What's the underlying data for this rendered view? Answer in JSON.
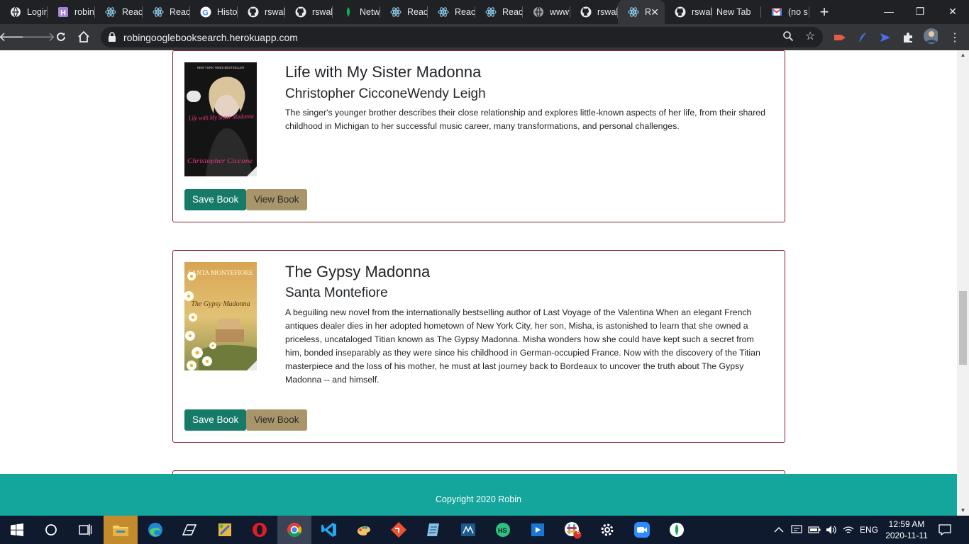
{
  "browser": {
    "tabs": [
      {
        "label": "Login",
        "icon": "globe-icon"
      },
      {
        "label": "robin",
        "icon": "heroku-icon"
      },
      {
        "label": "React",
        "icon": "react-icon"
      },
      {
        "label": "React",
        "icon": "react-icon"
      },
      {
        "label": "Histo",
        "icon": "google-icon"
      },
      {
        "label": "rswal",
        "icon": "github-icon"
      },
      {
        "label": "rswal",
        "icon": "github-icon"
      },
      {
        "label": "Netw",
        "icon": "mongodb-leaf-icon"
      },
      {
        "label": "React",
        "icon": "react-icon"
      },
      {
        "label": "React",
        "icon": "react-icon"
      },
      {
        "label": "React",
        "icon": "react-icon"
      },
      {
        "label": "www",
        "icon": "globe-icon"
      },
      {
        "label": "rswal",
        "icon": "github-icon"
      },
      {
        "label": "R",
        "icon": "react-icon",
        "active": true
      },
      {
        "label": "rswal",
        "icon": "github-icon"
      },
      {
        "label": "New Tab",
        "icon": ""
      },
      {
        "label": "(no s",
        "icon": "gmail-icon"
      }
    ],
    "url": "robingooglebooksearch.herokuapp.com"
  },
  "books": [
    {
      "title": "Life with My Sister Madonna",
      "authors": "Christopher CicconeWendy Leigh",
      "description": "The singer's younger brother describes their close relationship and explores little-known aspects of her life, from their shared childhood in Michigan to her successful music career, many transformations, and personal challenges.",
      "save_label": "Save Book",
      "view_label": "View Book",
      "cover": {
        "top_text": "NEW YORK TIMES BESTSELLER",
        "title_text": "Life with My Sister Madonna",
        "author_text": "Christopher Ciccone"
      }
    },
    {
      "title": "The Gypsy Madonna",
      "authors": "Santa Montefiore",
      "description": "A beguiling new novel from the internationally bestselling author of Last Voyage of the Valentina When an elegant French antiques dealer dies in her adopted hometown of New York City, her son, Misha, is astonished to learn that she owned a priceless, uncataloged Titian known as The Gypsy Madonna. Misha wonders how she could have kept such a secret from him, bonded inseparably as they were since his childhood in German-occupied France. Now with the discovery of the Titian masterpiece and the loss of his mother, he must at last journey back to Bordeaux to uncover the truth about The Gypsy Madonna -- and himself.",
      "save_label": "Save Book",
      "view_label": "View Book",
      "cover": {
        "author_text": "SANTA MONTEFIORE",
        "title_text": "The Gypsy Madonna"
      }
    }
  ],
  "footer": {
    "text": "Copyright 2020 Robin"
  },
  "taskbar": {
    "language": "ENG",
    "time": "12:59 AM",
    "date": "2020-11-11",
    "slack_badge": "6"
  },
  "colors": {
    "card_border": "#8a1f2b",
    "save_button": "#157a68",
    "view_button": "#a8956a",
    "footer": "#14a69c"
  }
}
